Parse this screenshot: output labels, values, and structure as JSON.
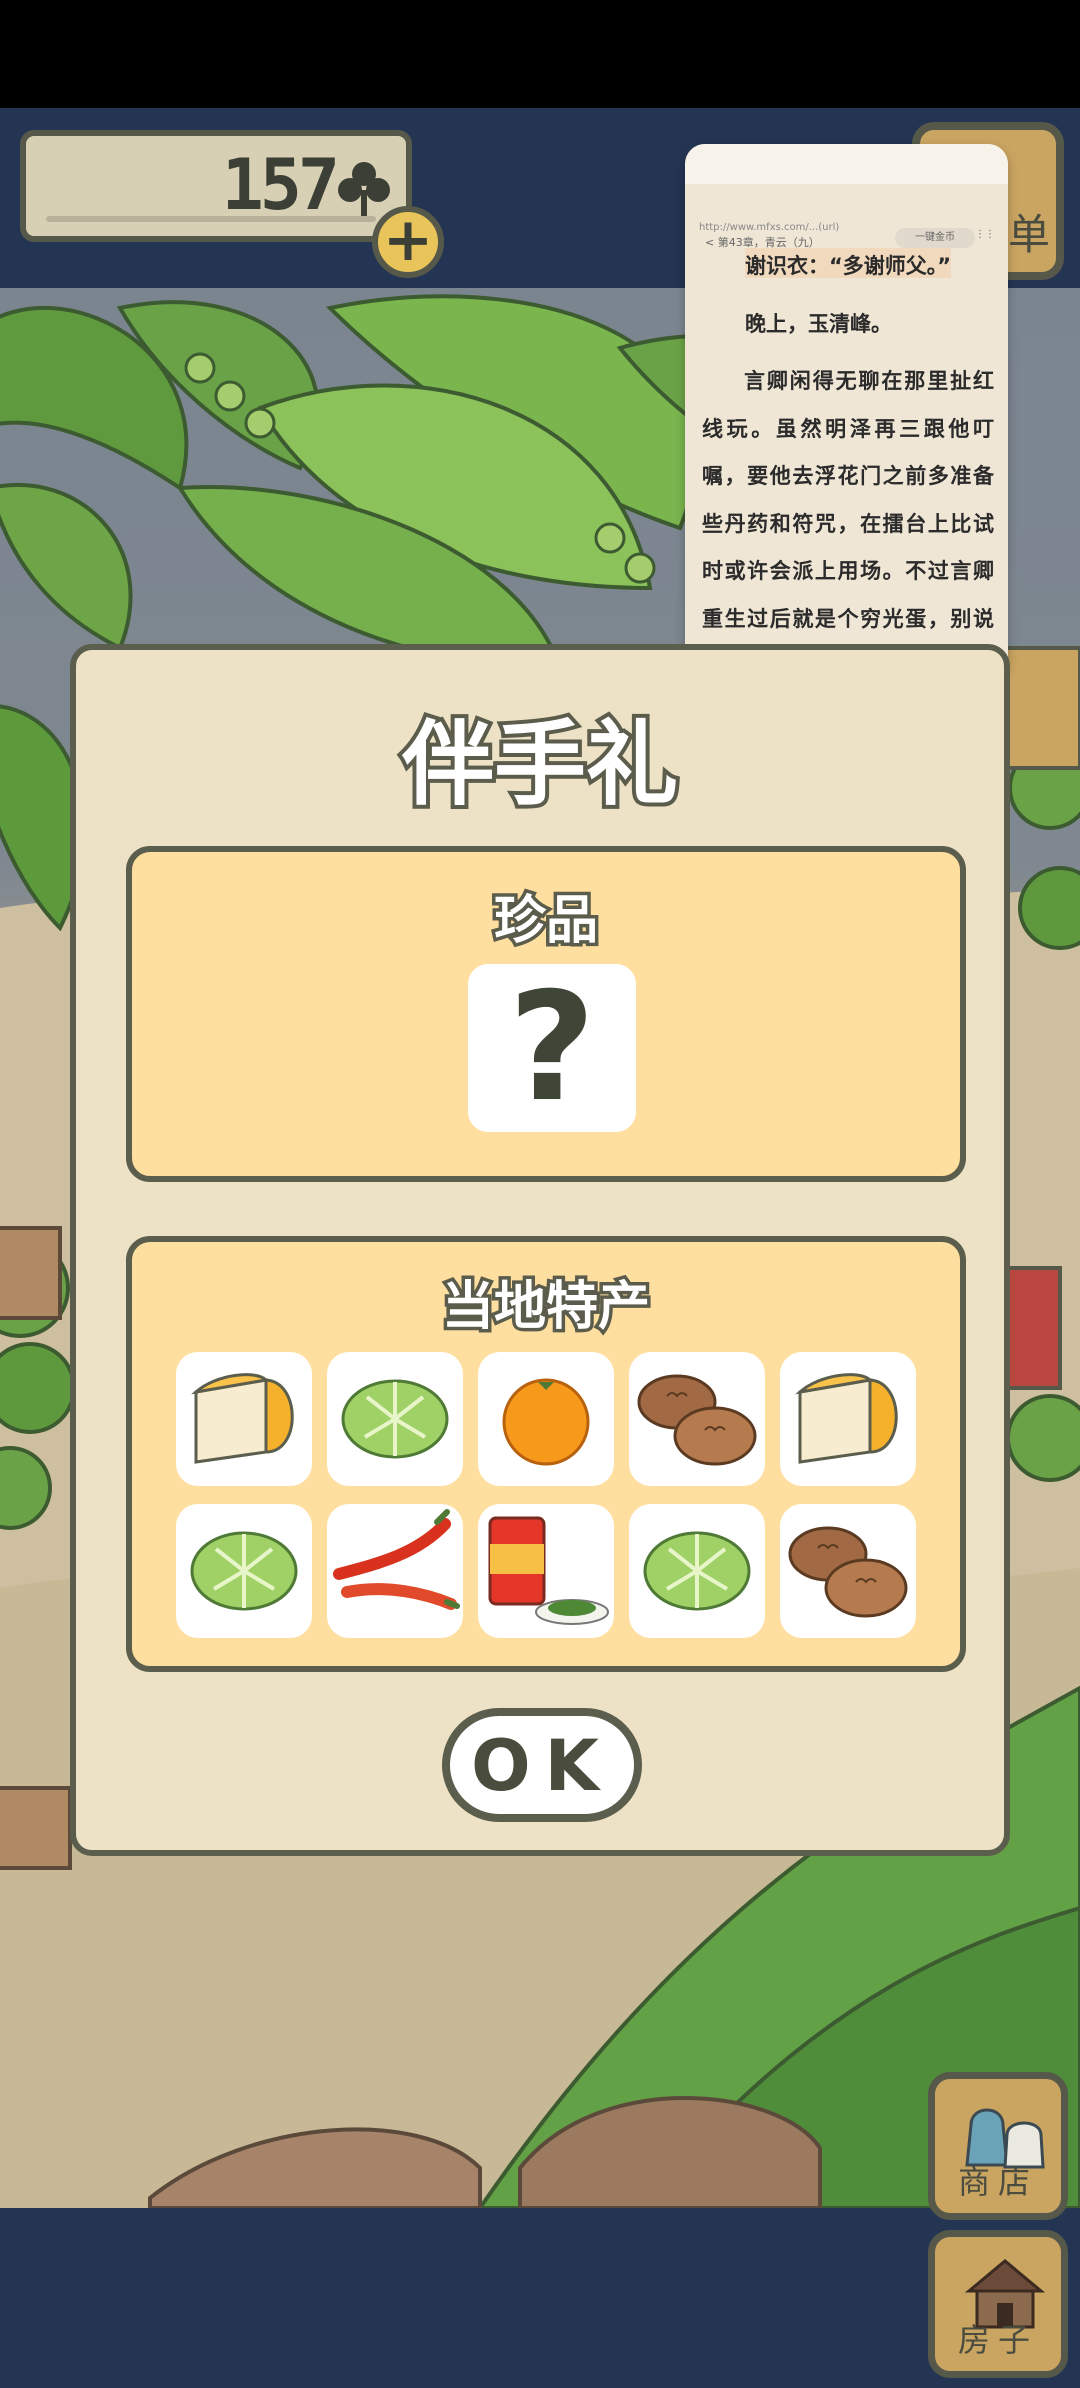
{
  "status": {},
  "clovers": {
    "count": "157",
    "icon": "clover-icon",
    "add_icon": "plus-icon"
  },
  "list_button": {
    "label": "单"
  },
  "reader": {
    "meta": "http://www.mfxs.com/...(url)",
    "chapter": "< 第43章，青云（九）",
    "pill": "一键金币",
    "dots": "⋮⋮",
    "highlight_line": "谢识衣：“多谢师父。”",
    "scene_line": "晚上，玉清峰。",
    "body": "言卿闲得无聊在那里扯红线玩。虽然明泽再三跟他叮嘱，要他去浮花门之前多准备些丹药和符咒，在擂台上比试时或许会派上用场。不过言卿重生过后就是个穷光蛋，别说丹药符咒，就是剑都靠自己削，加上谢衣之憾意外，压根"
  },
  "dialog": {
    "title": "伴手礼",
    "rare": {
      "title": "珍品",
      "mystery_symbol": "?"
    },
    "local": {
      "title": "当地特产",
      "items": [
        {
          "name": "cheese-icon"
        },
        {
          "name": "cabbage-icon"
        },
        {
          "name": "orange-icon"
        },
        {
          "name": "buns-icon"
        },
        {
          "name": "cheese-icon"
        },
        {
          "name": "cabbage-icon"
        },
        {
          "name": "chili-icon"
        },
        {
          "name": "tea-can-icon"
        },
        {
          "name": "cabbage-icon"
        },
        {
          "name": "buns-icon"
        }
      ]
    },
    "ok_label": "OK"
  },
  "side_buttons": {
    "shop_label": "商店",
    "house_label": "房子"
  },
  "colors": {
    "navy": "#243553",
    "panel": "#ffdfa0",
    "dialog": "#ede2c5",
    "outline": "#5b5e4c"
  }
}
